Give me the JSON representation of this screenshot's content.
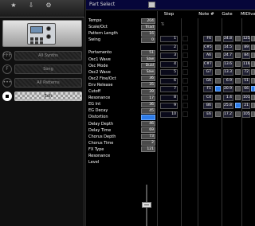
{
  "toolbar": {
    "items": [
      {
        "icon": "star-icon",
        "glyph": "★",
        "label": ""
      },
      {
        "icon": "download-icon",
        "glyph": "⇩",
        "label": ""
      },
      {
        "icon": "settings-icon",
        "glyph": "⚙",
        "label": ""
      }
    ]
  },
  "device": {
    "name": "synthesizer-device-image"
  },
  "nav": {
    "items": [
      {
        "bullet": "FFF",
        "label": "All Synths",
        "active": false
      },
      {
        "bullet": "F",
        "label": "Song",
        "active": false
      },
      {
        "bullet": "•••",
        "label": "All Patterns",
        "active": false
      },
      {
        "bullet": "",
        "label": "Edit",
        "active": true
      }
    ]
  },
  "header": {
    "part_select_label": "Part Select"
  },
  "seq_header": {
    "step": "Step",
    "note": "Note #",
    "gate": "Gate",
    "velocity": "MIDIvalue",
    "step_offset": "Ti"
  },
  "params": [
    {
      "label": "Tempo",
      "value": "204",
      "kind": "value"
    },
    {
      "label": "Scale/Oct",
      "value": "Triad",
      "kind": "value"
    },
    {
      "label": "Pattern Length",
      "value": "16",
      "kind": "value"
    },
    {
      "label": "Swing",
      "value": "0",
      "kind": "value"
    },
    {
      "label": "",
      "value": "",
      "kind": "spacer"
    },
    {
      "label": "Portamento",
      "value": "51",
      "kind": "value"
    },
    {
      "label": "Osc1 Wave",
      "value": "Saw",
      "kind": "value"
    },
    {
      "label": "Osc Mode",
      "value": "Dual",
      "kind": "value"
    },
    {
      "label": "Osc2 Wave",
      "value": "Saw",
      "kind": "value"
    },
    {
      "label": "Osc2 Fine/Oct",
      "value": "36",
      "kind": "value"
    },
    {
      "label": "Env Release",
      "value": "35",
      "kind": "value"
    },
    {
      "label": "Cutoff",
      "value": "39",
      "kind": "value"
    },
    {
      "label": "Resonance",
      "value": "17",
      "kind": "value"
    },
    {
      "label": "EG Int",
      "value": "36",
      "kind": "value"
    },
    {
      "label": "EG Decay",
      "value": "45",
      "kind": "value"
    },
    {
      "label": "Distortion",
      "value": "",
      "kind": "toggle"
    },
    {
      "label": "Delay Depth",
      "value": "46",
      "kind": "value"
    },
    {
      "label": "Delay Time",
      "value": "69",
      "kind": "value"
    },
    {
      "label": "Chorus Depth",
      "value": "73",
      "kind": "value"
    },
    {
      "label": "Chorus Time",
      "value": "2",
      "kind": "value"
    },
    {
      "label": "FX Type",
      "value": "121",
      "kind": "value"
    },
    {
      "label": "Resonance",
      "value": "",
      "kind": "label"
    },
    {
      "label": "Level",
      "value": "",
      "kind": "label"
    }
  ],
  "steps": [
    {
      "step": "1",
      "note": "F6",
      "gate": "24.8",
      "vel": "125",
      "note_on": false,
      "gate_on": false,
      "vel_on": false
    },
    {
      "step": "2",
      "note": "C#5",
      "gate": "14.5",
      "vel": "89",
      "note_on": false,
      "gate_on": false,
      "vel_on": false
    },
    {
      "step": "3",
      "note": "A6",
      "gate": "24.7",
      "vel": "84",
      "note_on": false,
      "gate_on": false,
      "vel_on": false
    },
    {
      "step": "4",
      "note": "C#7",
      "gate": "13.6",
      "vel": "116",
      "note_on": false,
      "gate_on": false,
      "vel_on": false
    },
    {
      "step": "5",
      "note": "G7",
      "gate": "13.3",
      "vel": "72",
      "note_on": false,
      "gate_on": false,
      "vel_on": false
    },
    {
      "step": "6",
      "note": "G6",
      "gate": "6.9",
      "vel": "51",
      "note_on": false,
      "gate_on": false,
      "vel_on": false
    },
    {
      "step": "7",
      "note": "F1",
      "gate": "20.9",
      "vel": "66",
      "note_on": true,
      "gate_on": false,
      "vel_on": true
    },
    {
      "step": "8",
      "note": "C4",
      "gate": "1.4",
      "vel": "101",
      "note_on": false,
      "gate_on": false,
      "vel_on": false
    },
    {
      "step": "9",
      "note": "B6",
      "gate": "25.8",
      "vel": "21",
      "note_on": false,
      "gate_on": true,
      "vel_on": false
    },
    {
      "step": "10",
      "note": "E6",
      "gate": "17.2",
      "vel": "105",
      "note_on": false,
      "gate_on": false,
      "vel_on": false
    }
  ],
  "colors": {
    "accent": "#2e7ce8",
    "header_bg": "#06063a"
  }
}
